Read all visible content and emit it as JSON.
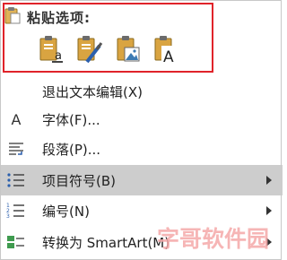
{
  "paste": {
    "title": "粘贴选项:",
    "options": [
      {
        "icon": "paste-keep-text-only-icon"
      },
      {
        "icon": "paste-keep-formatting-icon"
      },
      {
        "icon": "paste-picture-icon"
      },
      {
        "icon": "paste-text-only-icon"
      }
    ]
  },
  "menu": {
    "items": [
      {
        "label": "退出文本编辑(X)",
        "icon": "none",
        "submenu": false,
        "highlighted": false
      },
      {
        "label": "字体(F)...",
        "icon": "font-icon",
        "submenu": false,
        "highlighted": false
      },
      {
        "label": "段落(P)...",
        "icon": "paragraph-icon",
        "submenu": false,
        "highlighted": false
      },
      {
        "label": "项目符号(B)",
        "icon": "bullets-icon",
        "submenu": true,
        "highlighted": true
      },
      {
        "label": "编号(N)",
        "icon": "numbering-icon",
        "submenu": true,
        "highlighted": false
      },
      {
        "label": "转换为 SmartArt(M)",
        "icon": "smartart-icon",
        "submenu": true,
        "highlighted": false
      }
    ]
  },
  "watermark": {
    "text": "字哥软件园"
  },
  "colors": {
    "highlight": "#cdcdcd",
    "frame": "#e0232a",
    "clipboard": "#d9a441",
    "accent_blue": "#2b5fad"
  }
}
